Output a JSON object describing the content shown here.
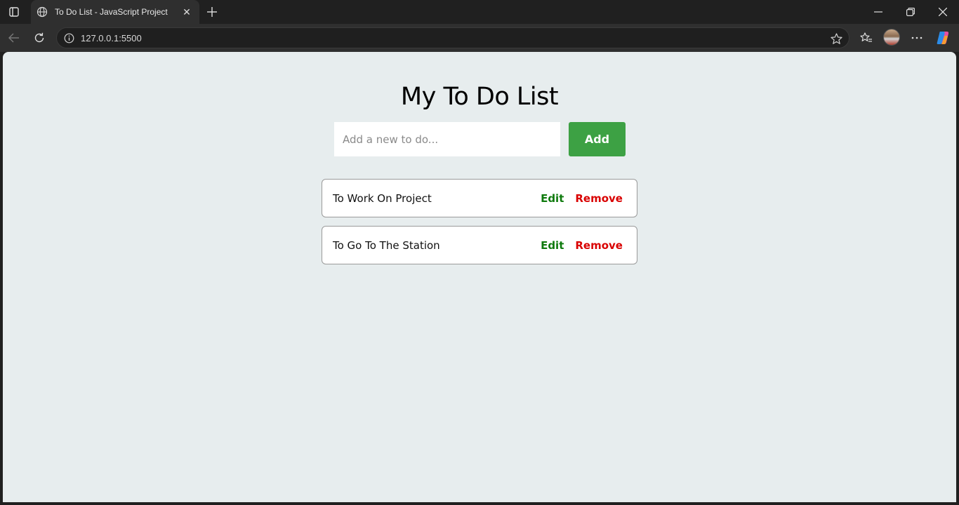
{
  "browser": {
    "tab_title": "To Do List - JavaScript Project",
    "tab_close": "✕",
    "url": "127.0.0.1:5500"
  },
  "page": {
    "title": "My To Do List",
    "input_placeholder": "Add a new to do...",
    "add_label": "Add",
    "todos": [
      {
        "text": "To Work On Project",
        "edit_label": "Edit",
        "remove_label": "Remove"
      },
      {
        "text": "To Go To The Station",
        "edit_label": "Edit",
        "remove_label": "Remove"
      }
    ]
  },
  "colors": {
    "page_background": "#e7edee",
    "add_button": "#3da144",
    "edit_text": "#0e7a0d",
    "remove_text": "#d90000"
  }
}
